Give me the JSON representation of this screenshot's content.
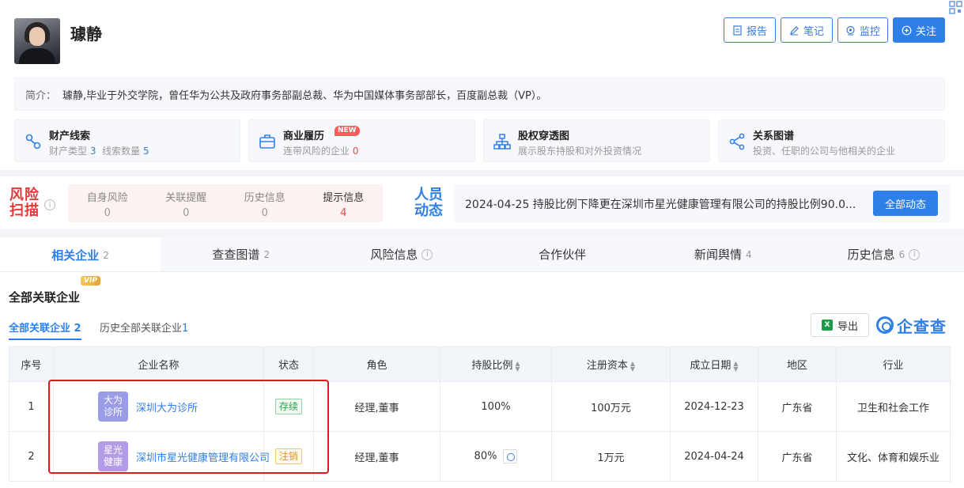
{
  "person": {
    "name": "璩静"
  },
  "header_buttons": [
    {
      "label": "报告",
      "icon": "report-icon"
    },
    {
      "label": "笔记",
      "icon": "edit-icon"
    },
    {
      "label": "监控",
      "icon": "monitor-icon"
    },
    {
      "label": "关注",
      "icon": "plus-circle-icon"
    }
  ],
  "intro": {
    "label": "简介：",
    "text": "璩静,毕业于外交学院，曾任华为公共及政府事务部副总裁、华为中国媒体事务部部长，百度副总裁（VP）。"
  },
  "cards": [
    {
      "title": "财产线索",
      "sub_a": "财产类型",
      "num_a": "3",
      "sub_b": "线索数量",
      "num_b": "5",
      "icon": "link-icon"
    },
    {
      "title": "商业履历",
      "tag": "NEW",
      "sub_a": "连带风险的企业",
      "num_a": "0",
      "icon": "briefcase-icon"
    },
    {
      "title": "股权穿透图",
      "sub_a": "展示股东持股和对外投资情况",
      "icon": "org-chart-icon"
    },
    {
      "title": "关系图谱",
      "sub_a": "投资、任职的公司与他相关的企业",
      "icon": "share-icon"
    }
  ],
  "risk": {
    "logo_line1": "风险",
    "logo_line2": "扫描",
    "cells": [
      {
        "label": "自身风险",
        "value": "0"
      },
      {
        "label": "关联提醒",
        "value": "0"
      },
      {
        "label": "历史信息",
        "value": "0"
      },
      {
        "label": "提示信息",
        "value": "4"
      }
    ]
  },
  "dynamics": {
    "logo_line1": "人员",
    "logo_line2": "动态",
    "text": "2024-04-25  持股比例下降更在深圳市星光健康管理有限公司的持股比例90.0...",
    "button": "全部动态"
  },
  "tabs": [
    {
      "label": "相关企业",
      "count": "2",
      "active": true
    },
    {
      "label": "查查图谱",
      "count": "2"
    },
    {
      "label": "风险信息",
      "info": true
    },
    {
      "label": "合作伙伴"
    },
    {
      "label": "新闻舆情",
      "count": "4"
    },
    {
      "label": "历史信息",
      "count": "6",
      "info": true
    }
  ],
  "section": {
    "title": "全部关联企业",
    "vip": "VIP",
    "subtab_all": "全部关联企业",
    "subtab_all_count": "2",
    "subtab_hist": "历史全部关联企业",
    "subtab_hist_count": "1",
    "export": "导出",
    "brand": "企查查"
  },
  "table": {
    "headers": [
      "序号",
      "企业名称",
      "状态",
      "角色",
      "持股比例",
      "注册资本",
      "成立日期",
      "地区",
      "行业"
    ],
    "rows": [
      {
        "idx": "1",
        "logo": "大为\n诊所",
        "logo_color": "#9b9ce6",
        "name": "深圳大为诊所",
        "status": "存续",
        "status_type": "ok",
        "role": "经理,董事",
        "share": "100%",
        "capital": "100万元",
        "date": "2024-12-23",
        "region": "广东省",
        "industry": "卫生和社会工作"
      },
      {
        "idx": "2",
        "logo": "星光\n健康",
        "logo_color": "#b39be6",
        "name": "深圳市星光健康管理有限公司",
        "status": "注销",
        "status_type": "off",
        "role": "经理,董事",
        "share": "80%",
        "capital": "1万元",
        "date": "2024-04-24",
        "region": "广东省",
        "industry": "文化、体育和娱乐业"
      }
    ]
  }
}
